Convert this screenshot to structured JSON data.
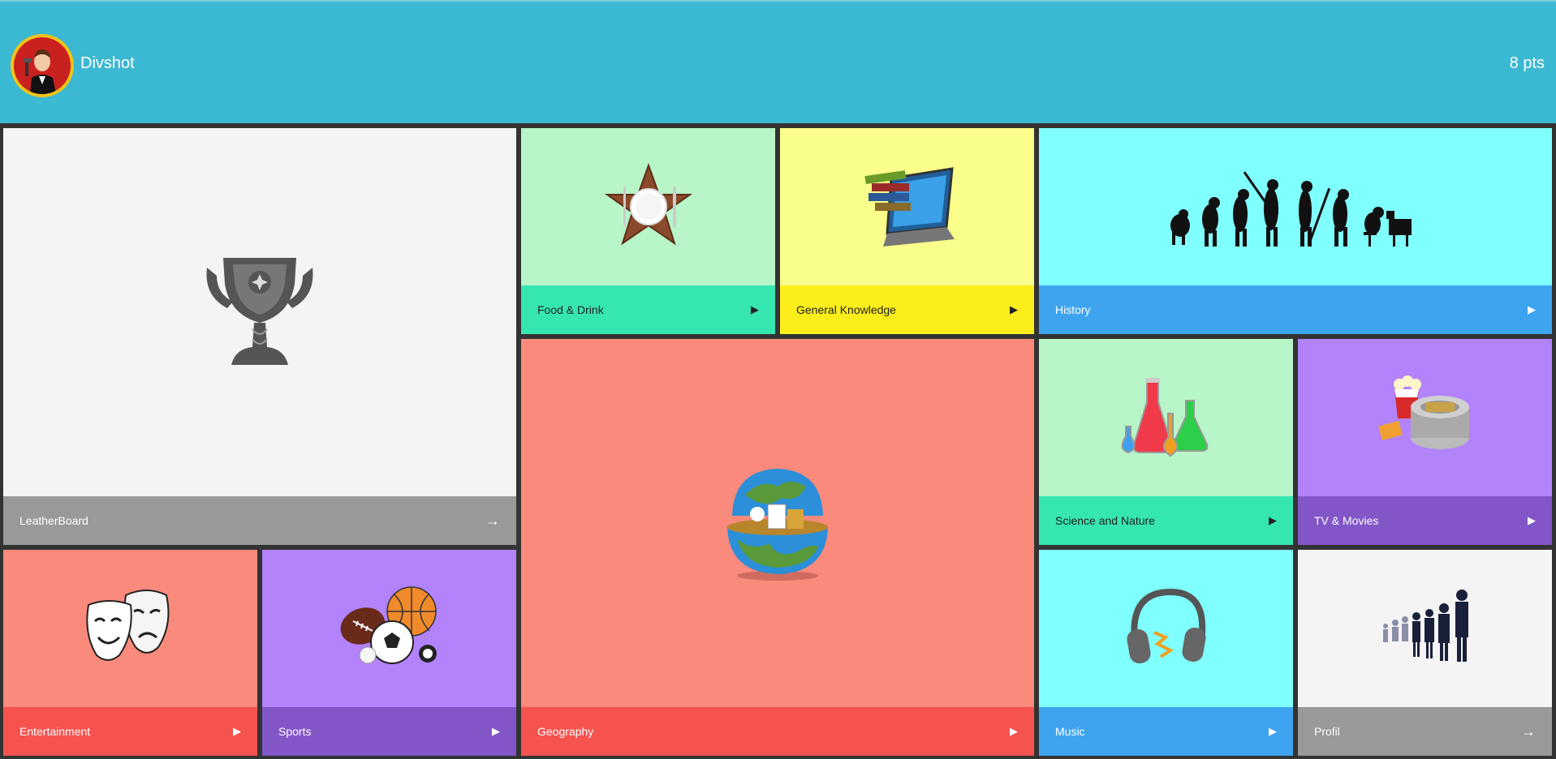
{
  "header": {
    "username": "Divshot",
    "points": "8 pts"
  },
  "tiles": [
    {
      "label": "LeatherBoard",
      "arrow": "→",
      "art": "trophy-icon",
      "bg": "#f4f4f4",
      "bar": "#999999"
    },
    {
      "label": "Food & Drink",
      "arrow": "▶",
      "art": "food-star-icon",
      "bg": "#b8f5c8",
      "bar": "#36e6b1"
    },
    {
      "label": "General Knowledge",
      "arrow": "▶",
      "art": "laptop-books-icon",
      "bg": "#f9ff8a",
      "bar": "#fbee1b"
    },
    {
      "label": "History",
      "arrow": "▶",
      "art": "evolution-icon",
      "bg": "#80ffff",
      "bar": "#3ea4f0"
    },
    {
      "label": "Geography",
      "arrow": "▶",
      "art": "globe-icon",
      "bg": "#f98a7c",
      "bar": "#f6534f"
    },
    {
      "label": "Science and Nature",
      "arrow": "▶",
      "art": "flasks-icon",
      "bg": "#b8f5c8",
      "bar": "#36e6b1"
    },
    {
      "label": "TV & Movies",
      "arrow": "▶",
      "art": "film-reel-icon",
      "bg": "#b283fb",
      "bar": "#8356c8"
    },
    {
      "label": "Entertainment",
      "arrow": "▶",
      "art": "theater-masks-icon",
      "bg": "#f98a7c",
      "bar": "#f6534f"
    },
    {
      "label": "Sports",
      "arrow": "▶",
      "art": "sports-balls-icon",
      "bg": "#b283fb",
      "bar": "#8356c8"
    },
    {
      "label": "Music",
      "arrow": "▶",
      "art": "headphones-icon",
      "bg": "#80ffff",
      "bar": "#3ea4f0"
    },
    {
      "label": "Profil",
      "arrow": "→",
      "art": "business-people-icon",
      "bg": "#f4f4f4",
      "bar": "#999999"
    }
  ]
}
